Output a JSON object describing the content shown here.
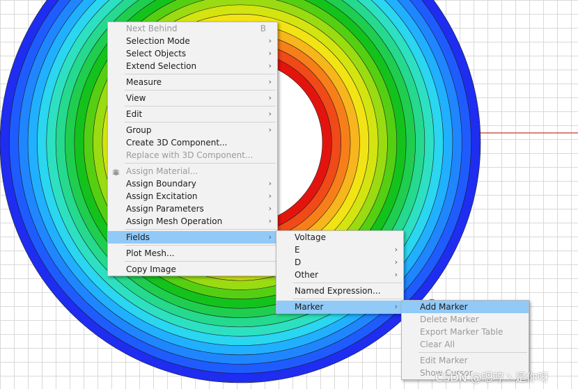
{
  "colors": {
    "highlight": "#91c9f7",
    "menu_bg": "#f2f2f2",
    "contour_bands": [
      "#1e2df0",
      "#1f5cff",
      "#1f86ff",
      "#20b0ff",
      "#2ad6f0",
      "#2ee0c2",
      "#25d98e",
      "#1fce4f",
      "#14c21c",
      "#55cf12",
      "#9adb12",
      "#d4e410",
      "#f2e414",
      "#f7b61c",
      "#f77f1a",
      "#ef4a18",
      "#e3140e"
    ],
    "axis_line": "#c0392b"
  },
  "context_menu": {
    "items": [
      {
        "label": "Next Behind",
        "shortcut": "B",
        "disabled": true
      },
      {
        "label": "Selection Mode",
        "submenu": true
      },
      {
        "label": "Select Objects",
        "submenu": true
      },
      {
        "label": "Extend Selection",
        "submenu": true
      },
      {
        "separator": true
      },
      {
        "label": "Measure",
        "submenu": true
      },
      {
        "separator": true
      },
      {
        "label": "View",
        "submenu": true
      },
      {
        "separator": true
      },
      {
        "label": "Edit",
        "submenu": true
      },
      {
        "separator": true
      },
      {
        "label": "Group",
        "submenu": true
      },
      {
        "label": "Create 3D Component..."
      },
      {
        "label": "Replace with 3D Component...",
        "disabled": true
      },
      {
        "separator": true
      },
      {
        "label": "Assign Material...",
        "disabled": true,
        "icon": "material-icon"
      },
      {
        "label": "Assign Boundary",
        "submenu": true
      },
      {
        "label": "Assign Excitation",
        "submenu": true
      },
      {
        "label": "Assign Parameters",
        "submenu": true
      },
      {
        "label": "Assign Mesh Operation",
        "submenu": true
      },
      {
        "separator": true
      },
      {
        "label": "Fields",
        "submenu": true,
        "highlighted": true
      },
      {
        "separator": true
      },
      {
        "label": "Plot Mesh..."
      },
      {
        "separator": true
      },
      {
        "label": "Copy Image"
      }
    ]
  },
  "fields_submenu": {
    "items": [
      {
        "label": "Voltage"
      },
      {
        "label": "E",
        "submenu": true
      },
      {
        "label": "D",
        "submenu": true
      },
      {
        "label": "Other",
        "submenu": true
      },
      {
        "separator": true
      },
      {
        "label": "Named Expression..."
      },
      {
        "separator": true
      },
      {
        "label": "Marker",
        "submenu": true,
        "highlighted": true
      }
    ]
  },
  "marker_submenu": {
    "items": [
      {
        "label": "Add Marker",
        "highlighted": true
      },
      {
        "label": "Delete Marker",
        "disabled": true
      },
      {
        "label": "Export Marker Table",
        "disabled": true
      },
      {
        "label": "Clear All",
        "disabled": true
      },
      {
        "separator": true
      },
      {
        "label": "Edit Marker",
        "disabled": true
      },
      {
        "label": "Show Cursor",
        "disabled": true
      }
    ]
  },
  "watermark": "CSDN @嗯哼丶是你呀"
}
